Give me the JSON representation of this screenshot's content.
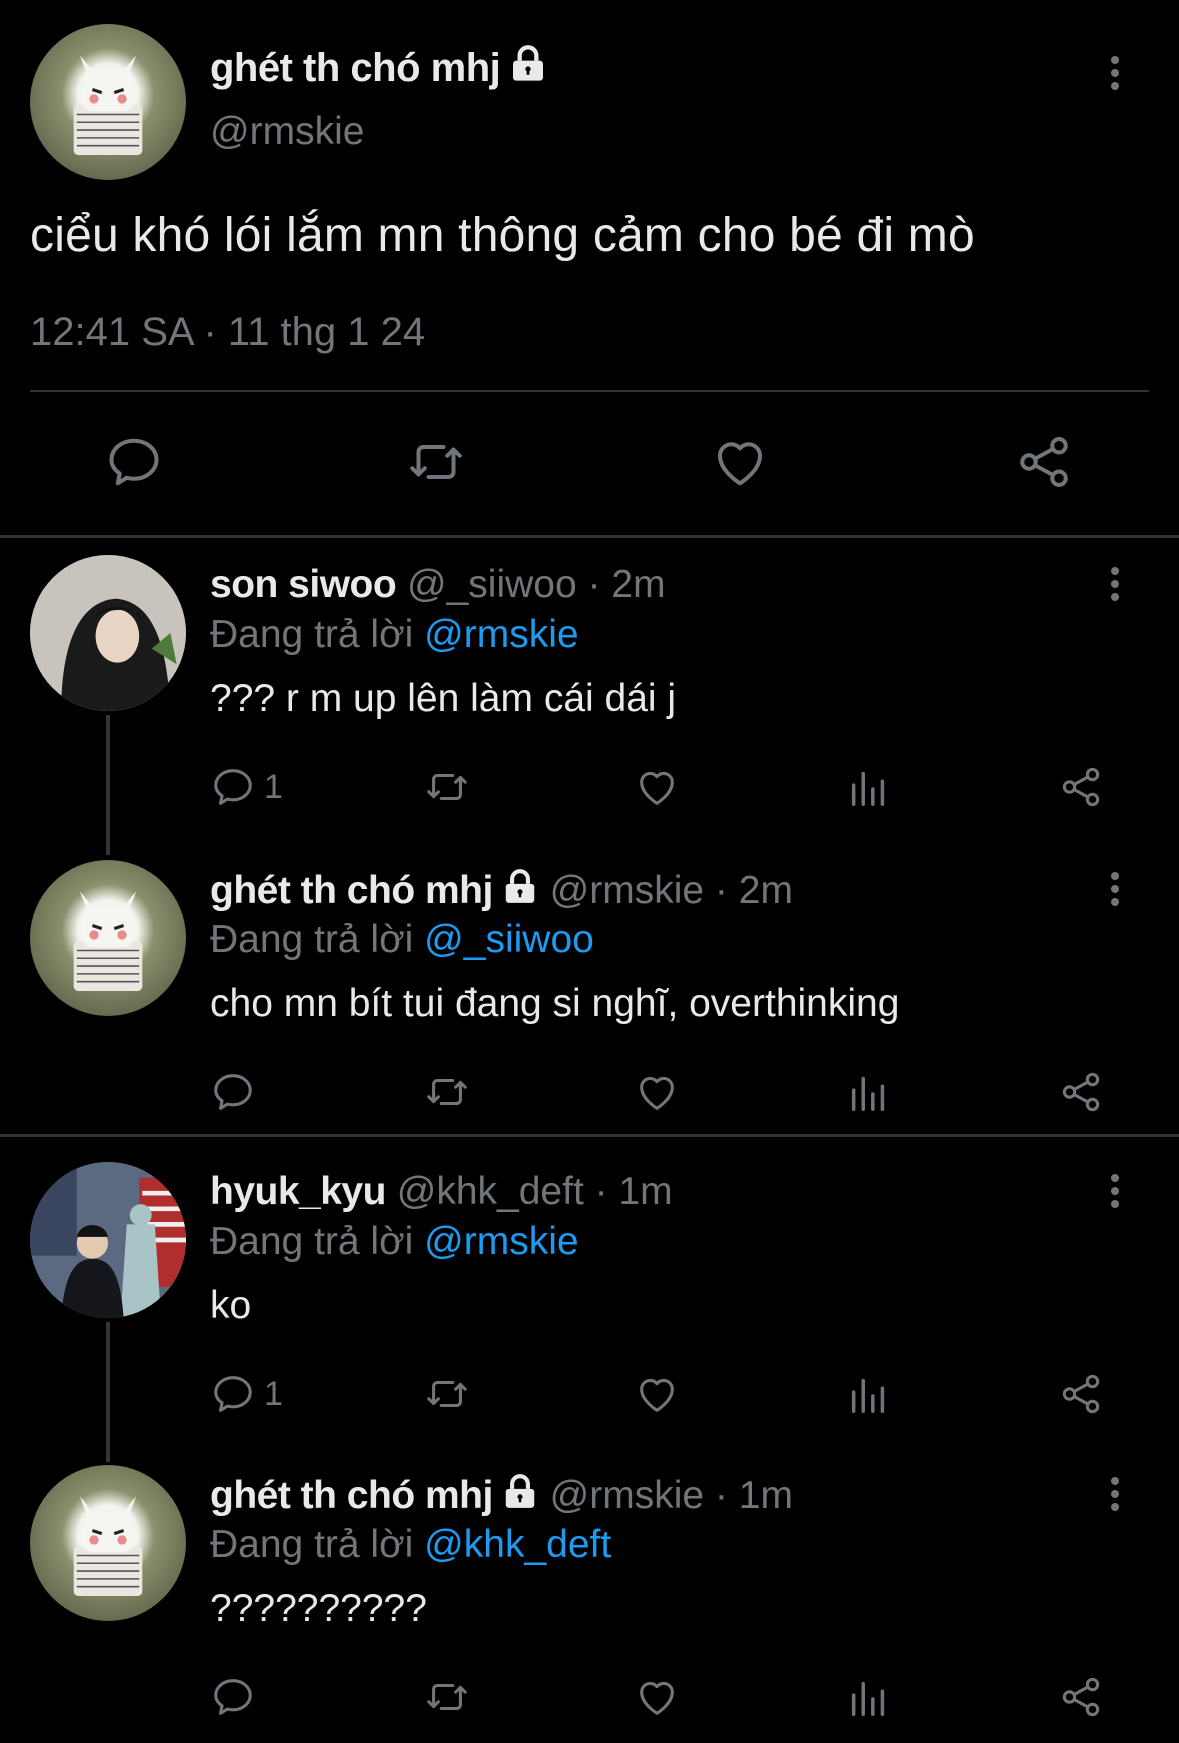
{
  "main_tweet": {
    "display_name": "ghét th chó mhj",
    "handle": "@rmskie",
    "text": "ciểu khó lói lắm mn thông cảm cho bé đi mò",
    "timestamp": "12:41 SA · 11 thg 1 24",
    "actions": [
      "reply-icon",
      "retweet-icon",
      "like-icon",
      "share-icon"
    ]
  },
  "replies": [
    {
      "display_name": "son siwoo",
      "handle": "@_siiwoo",
      "time": "2m",
      "replying_label": "Đang trả lời",
      "replying_to": "@rmskie",
      "text": "??? r m up lên làm cái dái j",
      "reply_count": "1",
      "locked": false,
      "avatar": "user-photo-hoodie"
    },
    {
      "display_name": "ghét th chó mhj",
      "handle": "@rmskie",
      "time": "2m",
      "replying_label": "Đang trả lời",
      "replying_to": "@_siiwoo",
      "text": "cho mn bít tui đang si nghĩ, overthinking",
      "reply_count": "",
      "locked": true,
      "avatar": "cat-reading-newspaper"
    },
    {
      "display_name": "hyuk_kyu",
      "handle": "@khk_deft",
      "time": "1m",
      "replying_label": "Đang trả lời",
      "replying_to": "@rmskie",
      "text": "ko",
      "reply_count": "1",
      "locked": false,
      "avatar": "user-photo-street"
    },
    {
      "display_name": "ghét th chó mhj",
      "handle": "@rmskie",
      "time": "1m",
      "replying_label": "Đang trả lời",
      "replying_to": "@khk_deft",
      "text": "??????????",
      "reply_count": "",
      "locked": true,
      "avatar": "cat-reading-newspaper"
    }
  ],
  "separator": "·",
  "colors": {
    "background": "#000000",
    "text": "#e7e9ea",
    "muted": "#71767b",
    "mention": "#1d9bf0",
    "divider": "#2f3336"
  }
}
